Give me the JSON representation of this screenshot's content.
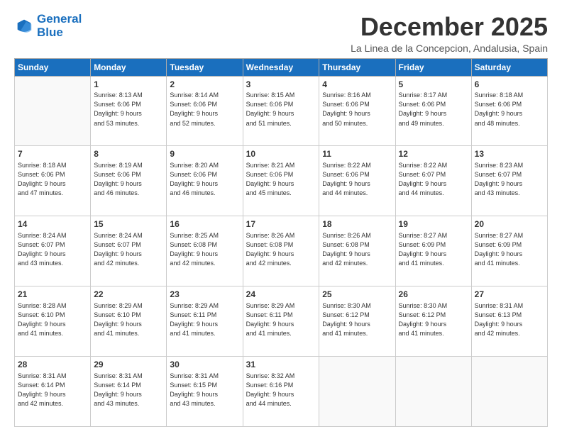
{
  "logo": {
    "line1": "General",
    "line2": "Blue"
  },
  "title": "December 2025",
  "subtitle": "La Linea de la Concepcion, Andalusia, Spain",
  "header_days": [
    "Sunday",
    "Monday",
    "Tuesday",
    "Wednesday",
    "Thursday",
    "Friday",
    "Saturday"
  ],
  "weeks": [
    [
      {
        "day": "",
        "info": ""
      },
      {
        "day": "1",
        "info": "Sunrise: 8:13 AM\nSunset: 6:06 PM\nDaylight: 9 hours\nand 53 minutes."
      },
      {
        "day": "2",
        "info": "Sunrise: 8:14 AM\nSunset: 6:06 PM\nDaylight: 9 hours\nand 52 minutes."
      },
      {
        "day": "3",
        "info": "Sunrise: 8:15 AM\nSunset: 6:06 PM\nDaylight: 9 hours\nand 51 minutes."
      },
      {
        "day": "4",
        "info": "Sunrise: 8:16 AM\nSunset: 6:06 PM\nDaylight: 9 hours\nand 50 minutes."
      },
      {
        "day": "5",
        "info": "Sunrise: 8:17 AM\nSunset: 6:06 PM\nDaylight: 9 hours\nand 49 minutes."
      },
      {
        "day": "6",
        "info": "Sunrise: 8:18 AM\nSunset: 6:06 PM\nDaylight: 9 hours\nand 48 minutes."
      }
    ],
    [
      {
        "day": "7",
        "info": "Sunrise: 8:18 AM\nSunset: 6:06 PM\nDaylight: 9 hours\nand 47 minutes."
      },
      {
        "day": "8",
        "info": "Sunrise: 8:19 AM\nSunset: 6:06 PM\nDaylight: 9 hours\nand 46 minutes."
      },
      {
        "day": "9",
        "info": "Sunrise: 8:20 AM\nSunset: 6:06 PM\nDaylight: 9 hours\nand 46 minutes."
      },
      {
        "day": "10",
        "info": "Sunrise: 8:21 AM\nSunset: 6:06 PM\nDaylight: 9 hours\nand 45 minutes."
      },
      {
        "day": "11",
        "info": "Sunrise: 8:22 AM\nSunset: 6:06 PM\nDaylight: 9 hours\nand 44 minutes."
      },
      {
        "day": "12",
        "info": "Sunrise: 8:22 AM\nSunset: 6:07 PM\nDaylight: 9 hours\nand 44 minutes."
      },
      {
        "day": "13",
        "info": "Sunrise: 8:23 AM\nSunset: 6:07 PM\nDaylight: 9 hours\nand 43 minutes."
      }
    ],
    [
      {
        "day": "14",
        "info": "Sunrise: 8:24 AM\nSunset: 6:07 PM\nDaylight: 9 hours\nand 43 minutes."
      },
      {
        "day": "15",
        "info": "Sunrise: 8:24 AM\nSunset: 6:07 PM\nDaylight: 9 hours\nand 42 minutes."
      },
      {
        "day": "16",
        "info": "Sunrise: 8:25 AM\nSunset: 6:08 PM\nDaylight: 9 hours\nand 42 minutes."
      },
      {
        "day": "17",
        "info": "Sunrise: 8:26 AM\nSunset: 6:08 PM\nDaylight: 9 hours\nand 42 minutes."
      },
      {
        "day": "18",
        "info": "Sunrise: 8:26 AM\nSunset: 6:08 PM\nDaylight: 9 hours\nand 42 minutes."
      },
      {
        "day": "19",
        "info": "Sunrise: 8:27 AM\nSunset: 6:09 PM\nDaylight: 9 hours\nand 41 minutes."
      },
      {
        "day": "20",
        "info": "Sunrise: 8:27 AM\nSunset: 6:09 PM\nDaylight: 9 hours\nand 41 minutes."
      }
    ],
    [
      {
        "day": "21",
        "info": "Sunrise: 8:28 AM\nSunset: 6:10 PM\nDaylight: 9 hours\nand 41 minutes."
      },
      {
        "day": "22",
        "info": "Sunrise: 8:29 AM\nSunset: 6:10 PM\nDaylight: 9 hours\nand 41 minutes."
      },
      {
        "day": "23",
        "info": "Sunrise: 8:29 AM\nSunset: 6:11 PM\nDaylight: 9 hours\nand 41 minutes."
      },
      {
        "day": "24",
        "info": "Sunrise: 8:29 AM\nSunset: 6:11 PM\nDaylight: 9 hours\nand 41 minutes."
      },
      {
        "day": "25",
        "info": "Sunrise: 8:30 AM\nSunset: 6:12 PM\nDaylight: 9 hours\nand 41 minutes."
      },
      {
        "day": "26",
        "info": "Sunrise: 8:30 AM\nSunset: 6:12 PM\nDaylight: 9 hours\nand 41 minutes."
      },
      {
        "day": "27",
        "info": "Sunrise: 8:31 AM\nSunset: 6:13 PM\nDaylight: 9 hours\nand 42 minutes."
      }
    ],
    [
      {
        "day": "28",
        "info": "Sunrise: 8:31 AM\nSunset: 6:14 PM\nDaylight: 9 hours\nand 42 minutes."
      },
      {
        "day": "29",
        "info": "Sunrise: 8:31 AM\nSunset: 6:14 PM\nDaylight: 9 hours\nand 43 minutes."
      },
      {
        "day": "30",
        "info": "Sunrise: 8:31 AM\nSunset: 6:15 PM\nDaylight: 9 hours\nand 43 minutes."
      },
      {
        "day": "31",
        "info": "Sunrise: 8:32 AM\nSunset: 6:16 PM\nDaylight: 9 hours\nand 44 minutes."
      },
      {
        "day": "",
        "info": ""
      },
      {
        "day": "",
        "info": ""
      },
      {
        "day": "",
        "info": ""
      }
    ]
  ]
}
